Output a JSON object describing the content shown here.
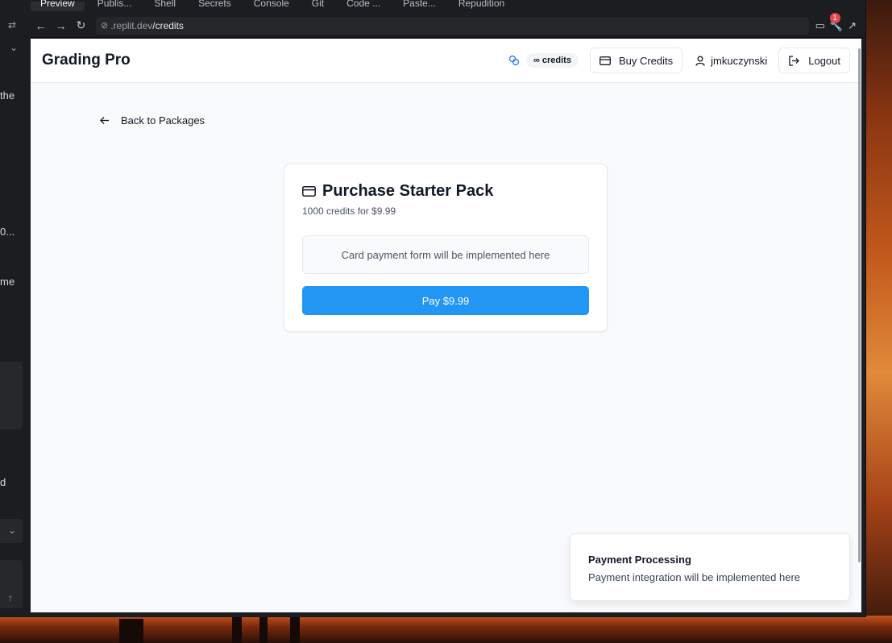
{
  "ide": {
    "tabs": [
      "Preview",
      "Publis...",
      "Shell",
      "Secrets",
      "Console",
      "Git",
      "Code ...",
      "Paste...",
      "Repudition"
    ],
    "left_panel": {
      "snippets": [
        "the",
        "0...",
        "me",
        "d"
      ]
    },
    "url": {
      "domain": ".replit.dev",
      "path": "/credits"
    },
    "notification_count": "1"
  },
  "app": {
    "brand": "Grading Pro",
    "credits_label": "∞ credits",
    "buy_credits_label": "Buy Credits",
    "username": "jmkuczynski",
    "logout_label": "Logout",
    "back_label": "Back to Packages",
    "card": {
      "title": "Purchase Starter Pack",
      "subtitle": "1000 credits for $9.99",
      "placeholder": "Card payment form will be implemented here",
      "pay_label": "Pay $9.99"
    },
    "toast": {
      "title": "Payment Processing",
      "description": "Payment integration will be implemented here"
    }
  },
  "colors": {
    "accent": "#2196f3",
    "badge": "#e5484d"
  },
  "icons": [
    "link-icon",
    "back-arrow-icon",
    "forward-arrow-icon",
    "reload-icon",
    "coins-icon",
    "credit-card-icon",
    "user-icon",
    "logout-icon",
    "arrow-left-icon",
    "chevron-down-icon",
    "arrow-up-icon",
    "devices-icon",
    "wrench-icon",
    "external-link-icon"
  ]
}
